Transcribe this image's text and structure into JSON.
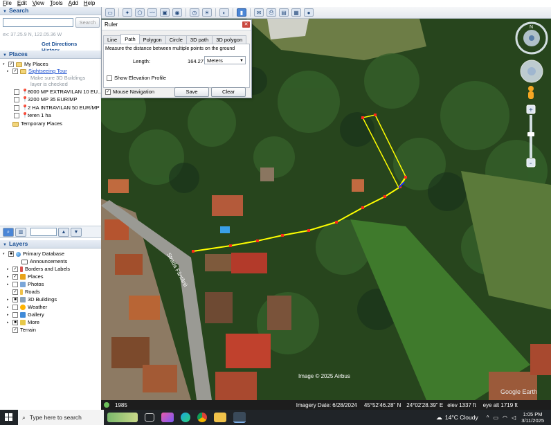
{
  "menu": {
    "items": [
      "File",
      "Edit",
      "View",
      "Tools",
      "Add",
      "Help"
    ]
  },
  "search": {
    "title": "Search",
    "placeholder": "",
    "button": "Search",
    "hint": "ex: 37.25.9 N, 122.05.36 W",
    "links": [
      "Get Directions",
      "History"
    ]
  },
  "places": {
    "title": "Places",
    "items": [
      {
        "label": "My Places",
        "checked": true
      },
      {
        "label": "Sightseeing Tour",
        "checked": true
      },
      {
        "label": "Make sure 3D Buildings",
        "checked": false
      },
      {
        "label": "layer is checked",
        "checked": false
      },
      {
        "label": "8000 MP EXTRAVILAN 10 EU...",
        "checked": false
      },
      {
        "label": "3200 MP 35 EUR/MP",
        "checked": false
      },
      {
        "label": "2 HA INTRAVILAN 50 EUR/MP",
        "checked": false
      },
      {
        "label": "teren 1 ha",
        "checked": false
      },
      {
        "label": "Temporary Places",
        "checked": false
      }
    ]
  },
  "layers": {
    "title": "Layers",
    "items": [
      {
        "label": "Primary Database"
      },
      {
        "label": "Announcements"
      },
      {
        "label": "Borders and Labels"
      },
      {
        "label": "Places"
      },
      {
        "label": "Photos"
      },
      {
        "label": "Roads"
      },
      {
        "label": "3D Buildings"
      },
      {
        "label": "Weather"
      },
      {
        "label": "Gallery"
      },
      {
        "label": "More"
      },
      {
        "label": "Terrain"
      }
    ]
  },
  "ruler": {
    "title": "Ruler",
    "tabs": [
      "Line",
      "Path",
      "Polygon",
      "Circle",
      "3D path",
      "3D polygon"
    ],
    "active_tab": "Path",
    "description": "Measure the distance between multiple points on the ground",
    "length_label": "Length:",
    "length_value": "164.27",
    "unit": "Meters",
    "show_elevation": "Show Elevation Profile",
    "mouse_navigation": "Mouse Navigation",
    "save": "Save",
    "clear": "Clear"
  },
  "map": {
    "street_label": "Strada Fântânii",
    "image_credit": "Image © 2025 Airbus",
    "logo": "Google Earth"
  },
  "status": {
    "year": "1985",
    "imagery_date": "Imagery Date: 6/28/2024",
    "lat": "45°52'46.28\" N",
    "lon": "24°02'28.39\" E",
    "elev": "elev  1337 ft",
    "eye_alt": "eye alt  1719 ft"
  },
  "taskbar": {
    "search_placeholder": "Type here to search",
    "weather": "14°C  Cloudy",
    "time": "1:05 PM",
    "date": "3/11/2025"
  },
  "colors": {
    "path": "#ffff00",
    "point": "#ff2a1a",
    "accent": "#1a4f94"
  }
}
